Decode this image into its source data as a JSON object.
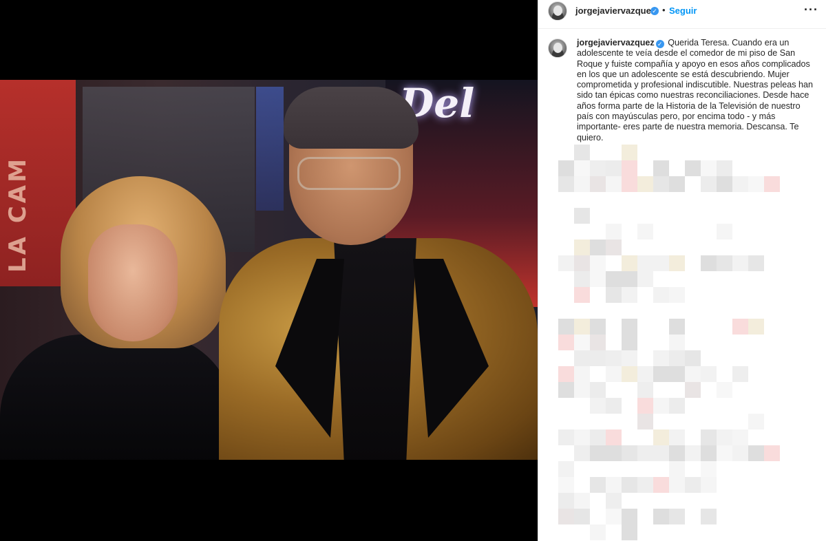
{
  "header": {
    "username": "jorgejaviervazquez",
    "verified_badge": "✓",
    "separator": "•",
    "follow_label": "Seguir",
    "more_icon": "···"
  },
  "post": {
    "caption_user": "jorgejaviervazquez",
    "caption_text": "Querida Teresa. Cuando era un adolescente te veía desde el comedor de mi piso de San Roque y fuiste compañía y apoyo en esos años complicados en los que un adolescente se está descubriendo. Mujer comprometida y profesional indiscutible. Nuestras peleas han sido tan épicas como nuestras reconciliaciones. Desde hace años forma parte de la Historia de la Televisión de nuestro país con mayúsculas pero, por encima todo - y más importante- eres parte de nuestra memoria. Descansa. Te quiero."
  },
  "colors": {
    "link_blue": "#0095f6",
    "verified_blue": "#3897f0",
    "border": "#dbdbdb"
  },
  "icons": [
    "verified-badge-icon",
    "more-options-icon",
    "avatar"
  ]
}
